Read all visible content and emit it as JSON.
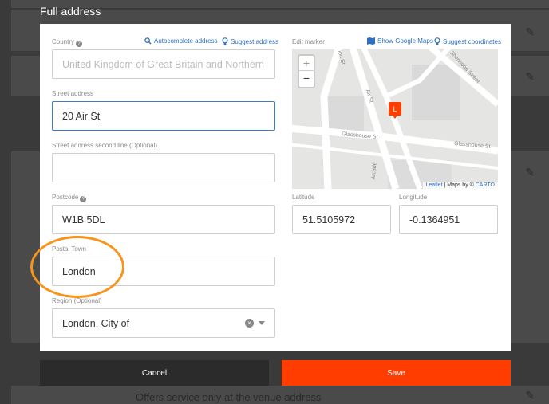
{
  "modal": {
    "title": "Full address"
  },
  "country": {
    "label": "Country",
    "autocomplete_label": "Autocomplete address",
    "suggest_label": "Suggest address",
    "placeholder": "United Kingdom of Great Britain and Northern"
  },
  "street": {
    "label": "Street address",
    "value": "20 Air St"
  },
  "street2": {
    "label": "Street address second line (Optional)",
    "value": ""
  },
  "postcode": {
    "label": "Postcode",
    "value": "W1B 5DL"
  },
  "postal_town": {
    "label": "Postal Town",
    "value": "London"
  },
  "region": {
    "label": "Region (Optional)",
    "value": "London, City of"
  },
  "map": {
    "label": "Edit marker",
    "show_maps_label": "Show Google Maps",
    "suggest_coords_label": "Suggest coordinates",
    "zoom_in": "+",
    "zoom_out": "−",
    "street_labels": [
      "Air St",
      "Glasshouse St",
      "Glasshouse St",
      "Sherwood Street",
      "Lion St",
      "Arcade"
    ],
    "attribution_leaflet": "Leaflet",
    "attribution_rest": " | Maps by © ",
    "attribution_carto": "CARTO"
  },
  "latitude": {
    "label": "Latitude",
    "value": "51.5105972"
  },
  "longitude": {
    "label": "Longitude",
    "value": "-0.1364951"
  },
  "buttons": {
    "cancel": "Cancel",
    "save": "Save"
  },
  "background": {
    "footer_text": "Offers service only at the venue address"
  },
  "colors": {
    "accent": "#ff3d00",
    "link": "#2d6fc0",
    "focus": "#3a7ec9",
    "highlight": "#f7941d"
  }
}
